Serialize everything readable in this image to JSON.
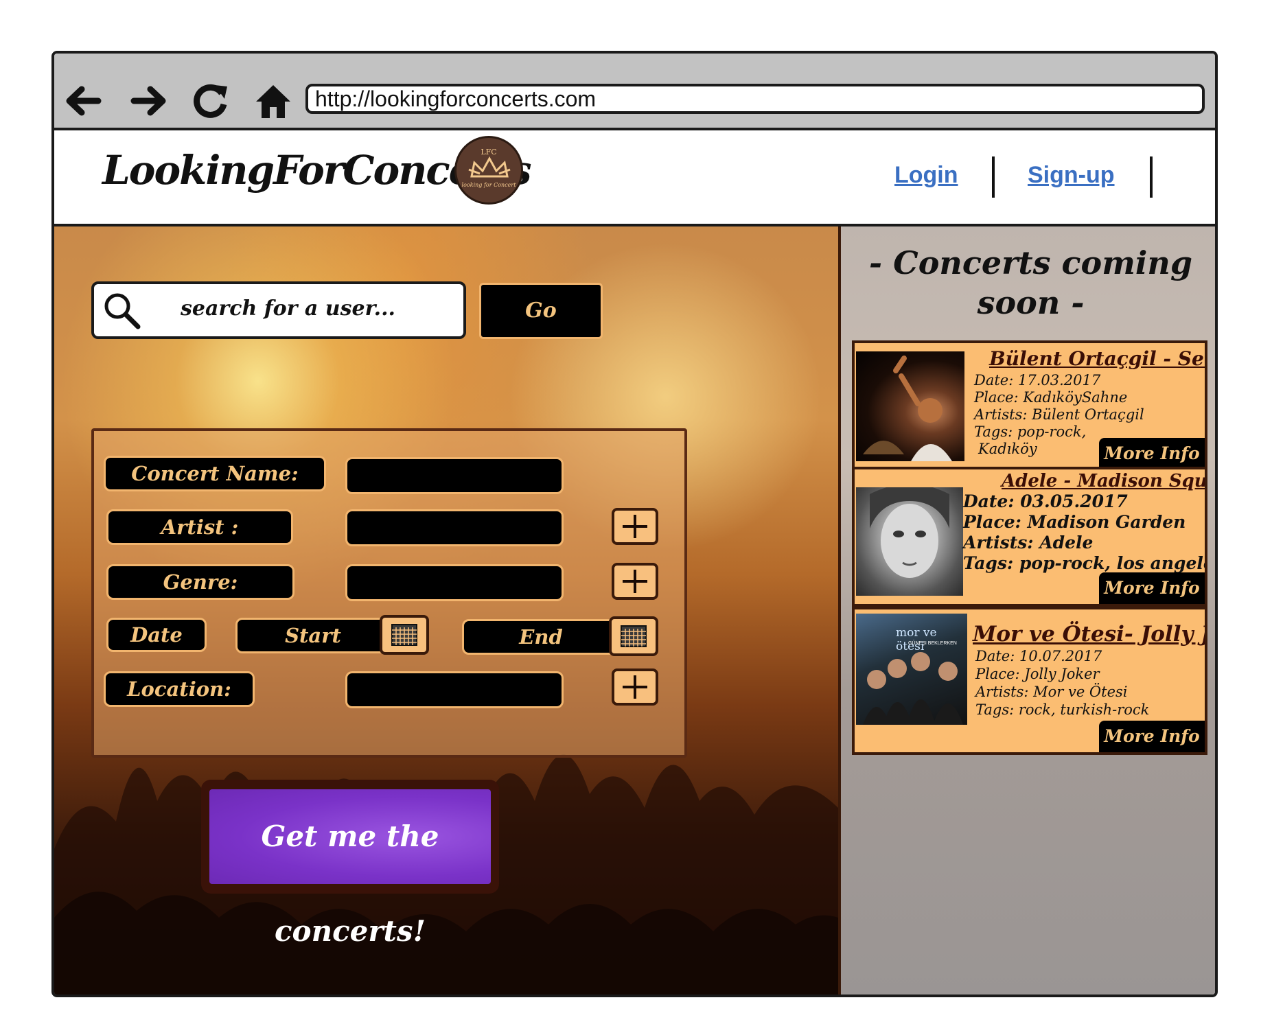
{
  "browser": {
    "url": "http://lookingforconcerts.com",
    "nav_icons": [
      "back-arrow-icon",
      "forward-arrow-icon",
      "reload-icon",
      "home-icon"
    ]
  },
  "header": {
    "brand": "LookingForConcerts",
    "logo": {
      "monogram": "LFC",
      "tagline": "looking for Concert"
    },
    "login": "Login",
    "signup": "Sign-up",
    "link_color": "#3a6fc2"
  },
  "search": {
    "placeholder": "search for a user...",
    "go_label": "Go"
  },
  "form": {
    "concert_name_label": "Concert Name:",
    "artist_label": "Artist :",
    "genre_label": "Genre:",
    "date_label": "Date",
    "start_label": "Start",
    "end_label": "End",
    "location_label": "Location:",
    "submit_label": "Get me the concerts!",
    "submit_color": "#7a32c8"
  },
  "sidebar": {
    "title_line1": "- Concerts coming",
    "title_line2": "soon -",
    "cards": [
      {
        "title": "Bülent Ortaçgil - Sen",
        "date": "Date:  17.03.2017",
        "place": "Place:  KadıköySahne",
        "artists": "Artists: Bülent Ortaçgil",
        "tags1": "Tags: pop-rock,",
        "tags2": "Kadıköy",
        "more": "More Info"
      },
      {
        "title": "Adele - Madison Square",
        "date": "Date: 03.05.2017",
        "place": "Place: Madison Garden",
        "artists": "Artists: Adele",
        "tags": "Tags: pop-rock, los angeles",
        "more": "More Info"
      },
      {
        "title": "Mor ve Ötesi- Jolly Joker",
        "date": "Date:  10.07.2017",
        "place": "Place:  Jolly Joker",
        "artists": "Artists: Mor ve Ötesi",
        "tags": "Tags: rock, turkish-rock",
        "album_text": "mor ve ötesi",
        "album_sub": "GÜNEŞI BEKLERKEN",
        "more": "More Info"
      }
    ],
    "card_color": "#fbbd72"
  }
}
